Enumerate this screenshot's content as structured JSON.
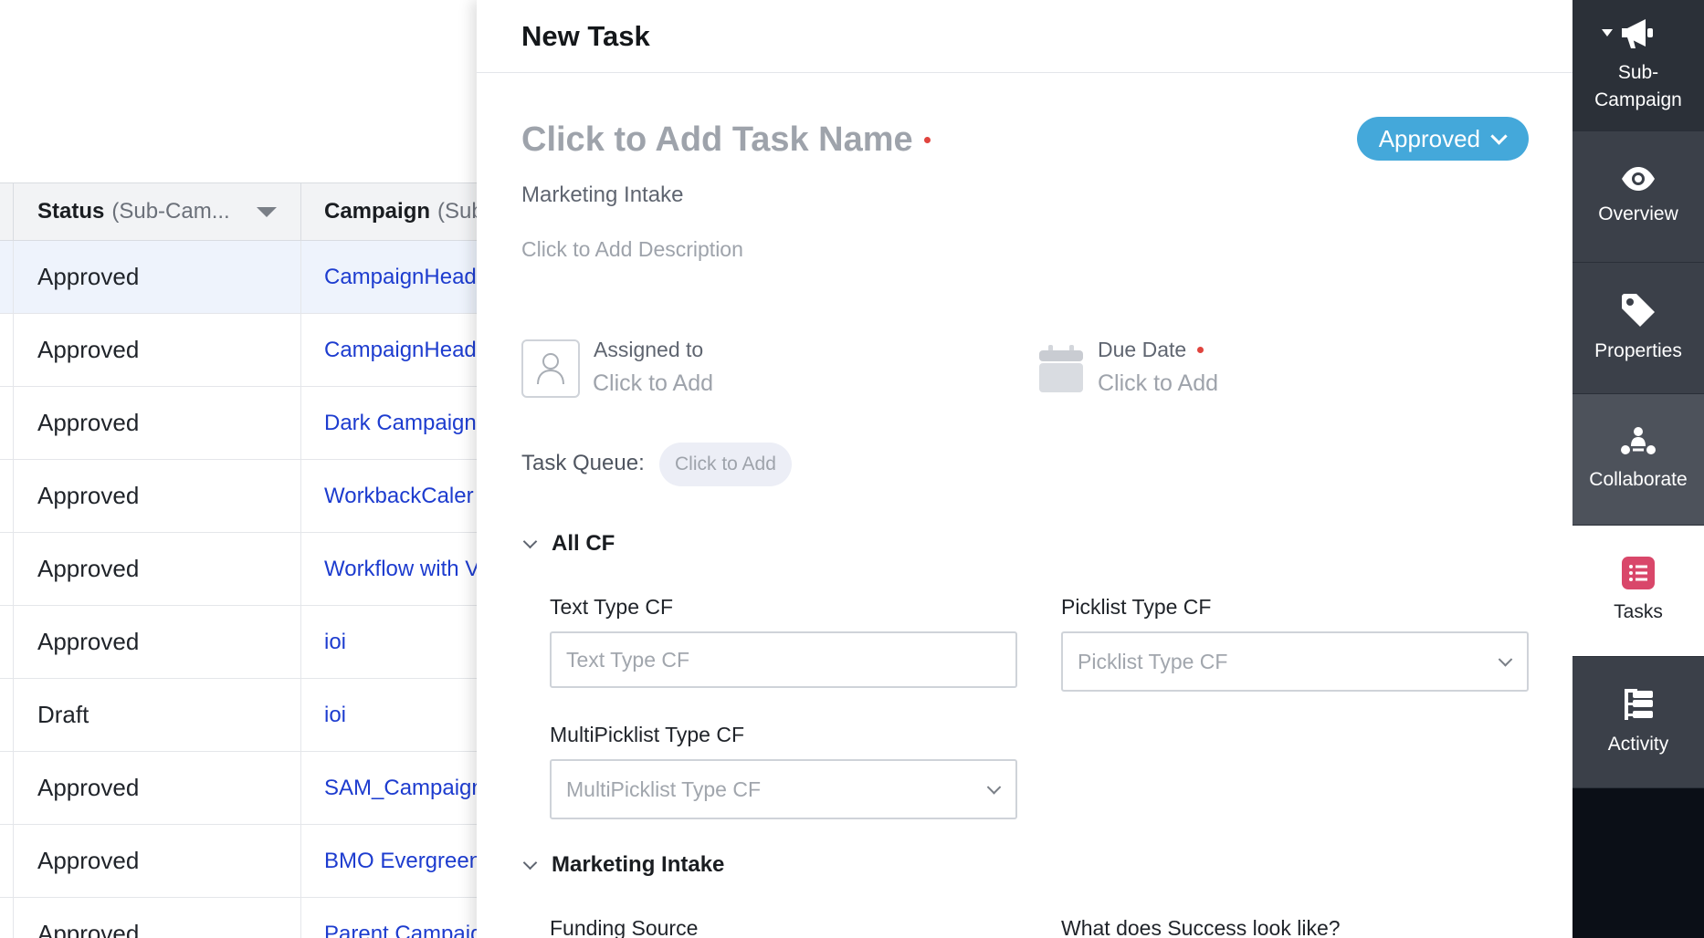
{
  "table": {
    "headers": [
      {
        "bold": "Status",
        "sub": "(Sub-Cam..."
      },
      {
        "bold": "Campaign",
        "sub": "(Sub"
      }
    ],
    "rows": [
      {
        "status": "Approved",
        "campaign": "CampaignHead"
      },
      {
        "status": "Approved",
        "campaign": "CampaignHead"
      },
      {
        "status": "Approved",
        "campaign": "Dark Campaign"
      },
      {
        "status": "Approved",
        "campaign": "WorkbackCaler"
      },
      {
        "status": "Approved",
        "campaign": "Workflow with V"
      },
      {
        "status": "Approved",
        "campaign": "ioi"
      },
      {
        "status": "Draft",
        "campaign": "ioi"
      },
      {
        "status": "Approved",
        "campaign": "SAM_Campaign"
      },
      {
        "status": "Approved",
        "campaign": "BMO Evergreen"
      },
      {
        "status": "Approved",
        "campaign": "Parent Campaig"
      }
    ]
  },
  "panel": {
    "title": "New Task",
    "task_name_placeholder": "Click to Add Task Name",
    "status_label": "Approved",
    "subtitle": "Marketing Intake",
    "description_placeholder": "Click to Add Description",
    "assigned_to_label": "Assigned to",
    "assigned_to_value": "Click to Add",
    "due_date_label": "Due Date",
    "due_date_value": "Click to Add",
    "task_queue_label": "Task Queue:",
    "task_queue_value": "Click to Add",
    "sections": {
      "all_cf": {
        "title": "All CF",
        "text_type_label": "Text Type CF",
        "text_type_placeholder": "Text Type CF",
        "picklist_label": "Picklist Type CF",
        "picklist_placeholder": "Picklist Type CF",
        "multipicklist_label": "MultiPicklist Type CF",
        "multipicklist_placeholder": "MultiPicklist Type CF"
      },
      "marketing_intake": {
        "title": "Marketing Intake",
        "funding_source_label": "Funding Source",
        "success_label": "What does Success look like?"
      }
    }
  },
  "rail": {
    "sub_campaign": "Sub-\nCampaign",
    "overview": "Overview",
    "properties": "Properties",
    "collaborate": "Collaborate",
    "tasks": "Tasks",
    "activity": "Activity"
  },
  "colors": {
    "status_button": "#44a8da",
    "link": "#1d3ccf",
    "required_dot": "#e0443e",
    "tasks_icon": "#d9476a"
  }
}
